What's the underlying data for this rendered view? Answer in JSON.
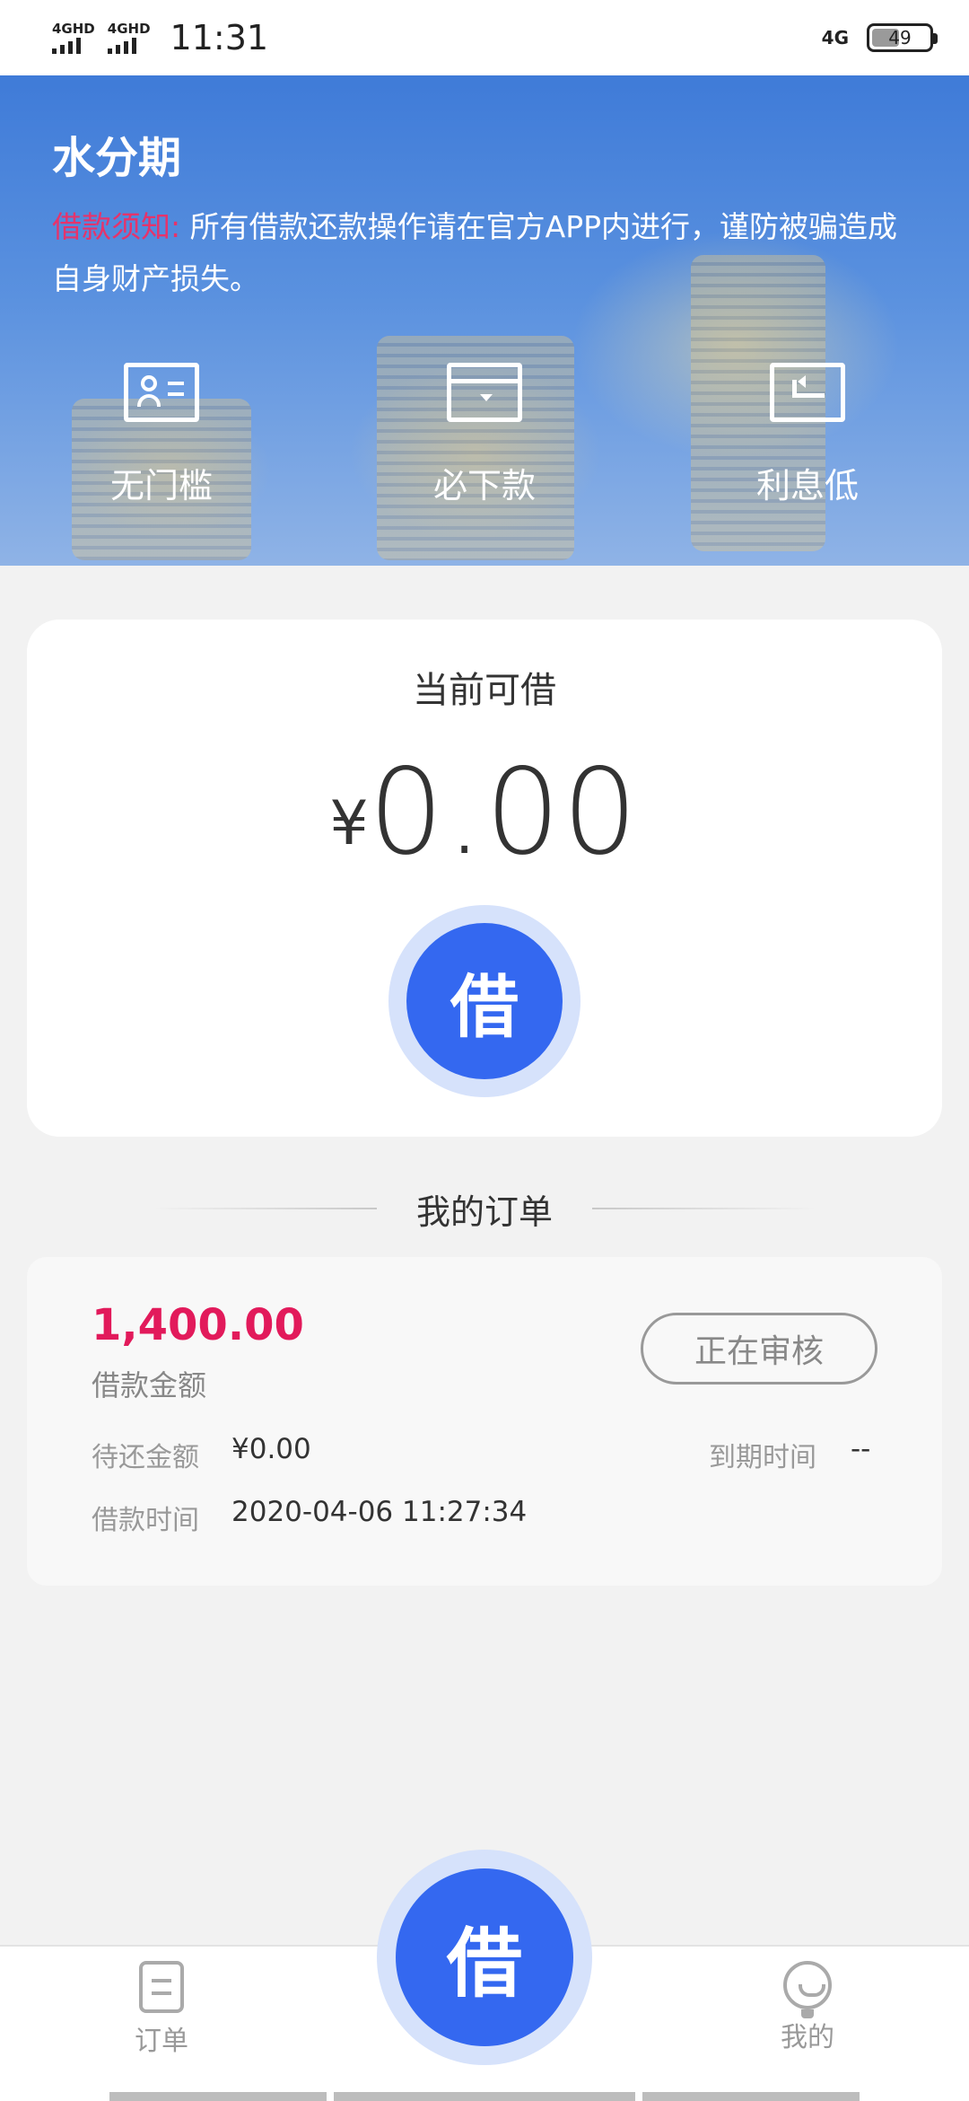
{
  "status_bar": {
    "network_1": "4GHD",
    "network_2": "4GHD",
    "time": "11:31",
    "data_network": "4G",
    "battery": "49",
    "battery_level": 0.49
  },
  "banner": {
    "title": "水分期",
    "notice_label": "借款须知:",
    "notice_text": "所有借款还款操作请在官方APP内进行，谨防被骗造成自身财产损失。",
    "features": [
      {
        "label": "无门槛",
        "icon": "id-card-icon"
      },
      {
        "label": "必下款",
        "icon": "card-icon"
      },
      {
        "label": "利息低",
        "icon": "return-icon"
      }
    ]
  },
  "loan": {
    "title": "当前可借",
    "currency": "¥",
    "amount": "0.00",
    "button": "借"
  },
  "orders": {
    "heading": "我的订单",
    "items": [
      {
        "amount": "1,400.00",
        "amount_label": "借款金额",
        "status": "正在审核",
        "pending_label": "待还金额",
        "pending_value": "¥0.00",
        "due_label": "到期时间",
        "due_value": "--",
        "time_label": "借款时间",
        "time_value": "2020-04-06 11:27:34"
      }
    ]
  },
  "bottom_nav": {
    "orders": "订单",
    "center": "借",
    "me": "我的"
  },
  "colors": {
    "accent_blue": "#3468f0",
    "accent_red": "#e21a5b",
    "notice_red": "#e6336b"
  }
}
